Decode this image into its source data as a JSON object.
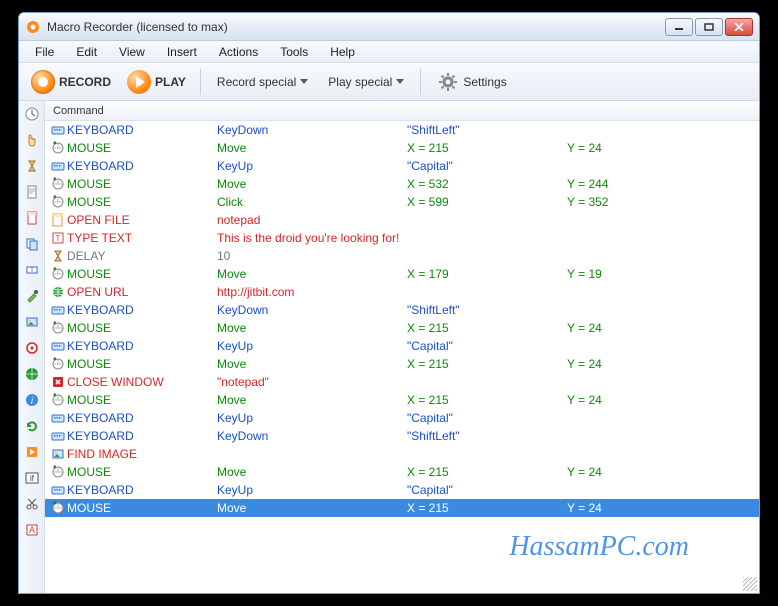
{
  "window": {
    "title": "Macro Recorder (licensed to max)"
  },
  "menu": {
    "file": "File",
    "edit": "Edit",
    "view": "View",
    "insert": "Insert",
    "actions": "Actions",
    "tools": "Tools",
    "help": "Help"
  },
  "toolbar": {
    "record": "RECORD",
    "play": "PLAY",
    "record_special": "Record special",
    "play_special": "Play special",
    "settings": "Settings"
  },
  "list": {
    "header": "Command",
    "rows": [
      {
        "type": "keyboard",
        "c1": "KEYBOARD",
        "c2": "KeyDown",
        "c3": "\"ShiftLeft\"",
        "c4": ""
      },
      {
        "type": "mouse",
        "c1": "MOUSE",
        "c2": "Move",
        "c3": "X = 215",
        "c4": "Y = 24"
      },
      {
        "type": "keyboard",
        "c1": "KEYBOARD",
        "c2": "KeyUp",
        "c3": "\"Capital\"",
        "c4": ""
      },
      {
        "type": "mouse",
        "c1": "MOUSE",
        "c2": "Move",
        "c3": "X = 532",
        "c4": "Y = 244"
      },
      {
        "type": "mouse",
        "c1": "MOUSE",
        "c2": "Click",
        "c3": "X = 599",
        "c4": "Y = 352"
      },
      {
        "type": "red",
        "icon": "file",
        "c1": "OPEN FILE",
        "c2": "notepad",
        "c3": "",
        "c4": ""
      },
      {
        "type": "red",
        "icon": "text",
        "c1": "TYPE TEXT",
        "c2": "This is the droid you're looking for!",
        "c3": "",
        "c4": ""
      },
      {
        "type": "gray",
        "icon": "delay",
        "c1": "DELAY",
        "c2": "10",
        "c3": "",
        "c4": ""
      },
      {
        "type": "mouse",
        "c1": "MOUSE",
        "c2": "Move",
        "c3": "X = 179",
        "c4": "Y = 19"
      },
      {
        "type": "red",
        "icon": "url",
        "c1": "OPEN URL",
        "c2": "http://jitbit.com",
        "c3": "",
        "c4": ""
      },
      {
        "type": "keyboard",
        "c1": "KEYBOARD",
        "c2": "KeyDown",
        "c3": "\"ShiftLeft\"",
        "c4": ""
      },
      {
        "type": "mouse",
        "c1": "MOUSE",
        "c2": "Move",
        "c3": "X = 215",
        "c4": "Y = 24"
      },
      {
        "type": "keyboard",
        "c1": "KEYBOARD",
        "c2": "KeyUp",
        "c3": "\"Capital\"",
        "c4": ""
      },
      {
        "type": "mouse",
        "c1": "MOUSE",
        "c2": "Move",
        "c3": "X = 215",
        "c4": "Y = 24"
      },
      {
        "type": "red",
        "icon": "close",
        "c1": "CLOSE WINDOW",
        "c2": "\"notepad\"",
        "c3": "",
        "c4": ""
      },
      {
        "type": "mouse",
        "c1": "MOUSE",
        "c2": "Move",
        "c3": "X = 215",
        "c4": "Y = 24"
      },
      {
        "type": "keyboard",
        "c1": "KEYBOARD",
        "c2": "KeyUp",
        "c3": "\"Capital\"",
        "c4": ""
      },
      {
        "type": "keyboard",
        "c1": "KEYBOARD",
        "c2": "KeyDown",
        "c3": "\"ShiftLeft\"",
        "c4": ""
      },
      {
        "type": "red",
        "icon": "image",
        "c1": "FIND IMAGE",
        "c2": "",
        "c3": "",
        "c4": ""
      },
      {
        "type": "mouse",
        "c1": "MOUSE",
        "c2": "Move",
        "c3": "X = 215",
        "c4": "Y = 24"
      },
      {
        "type": "keyboard",
        "c1": "KEYBOARD",
        "c2": "KeyUp",
        "c3": "\"Capital\"",
        "c4": ""
      },
      {
        "type": "mouse",
        "selected": true,
        "c1": "MOUSE",
        "c2": "Move",
        "c3": "X = 215",
        "c4": "Y = 24"
      }
    ]
  },
  "side_icons": [
    "clock",
    "hand",
    "hourglass",
    "page",
    "page2",
    "copy",
    "textbox",
    "eyedrop",
    "image",
    "target",
    "globe",
    "info",
    "refresh",
    "play",
    "if",
    "cut",
    "letter"
  ],
  "watermark": "HassamPC.com"
}
